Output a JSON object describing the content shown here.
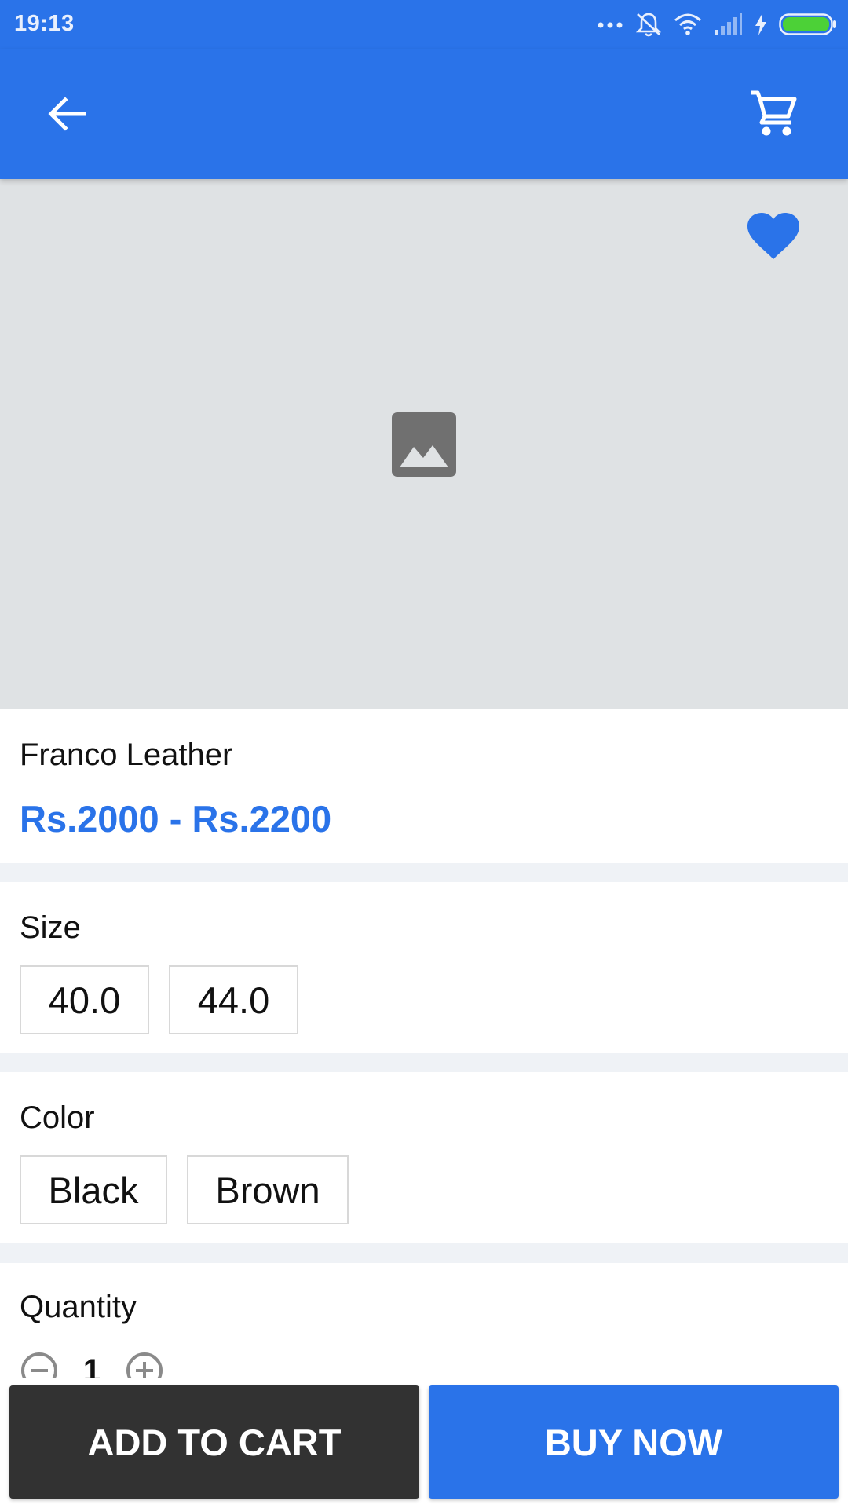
{
  "status_bar": {
    "time": "19:13",
    "icons": [
      "more-dots-icon",
      "vibrate-silent-icon",
      "wifi-icon",
      "cellular-signal-icon",
      "charging-icon",
      "battery-icon"
    ]
  },
  "app_bar": {
    "back_icon": "arrow-back-icon",
    "cart_icon": "shopping-cart-icon"
  },
  "product": {
    "favorite_icon": "heart-icon",
    "image_placeholder_icon": "image-icon",
    "name": "Franco Leather",
    "price": "Rs.2000 - Rs.2200"
  },
  "size": {
    "label": "Size",
    "options": [
      "40.0",
      "44.0"
    ]
  },
  "color": {
    "label": "Color",
    "options": [
      "Black",
      "Brown"
    ]
  },
  "quantity": {
    "label": "Quantity",
    "value": "1"
  },
  "actions": {
    "add_to_cart": "ADD TO CART",
    "buy_now": "BUY NOW"
  },
  "colors": {
    "primary": "#2a73e9",
    "dark_button": "#323232",
    "image_bg": "#dfe2e4",
    "separator": "#eff2f6",
    "battery_green": "#4cd137"
  }
}
